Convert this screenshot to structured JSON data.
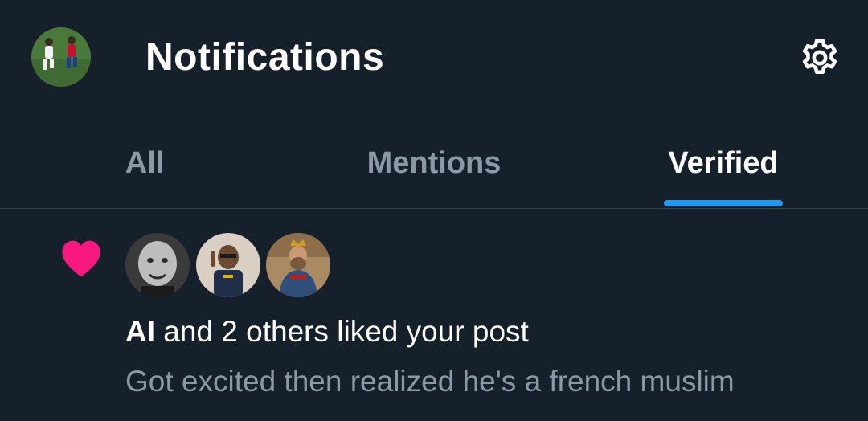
{
  "header": {
    "title": "Notifications",
    "avatar_icon": "profile-avatar",
    "settings_icon": "gear-icon"
  },
  "tabs": [
    {
      "label": "All",
      "active": false
    },
    {
      "label": "Mentions",
      "active": false
    },
    {
      "label": "Verified",
      "active": true
    }
  ],
  "notification": {
    "type_icon": "heart-icon",
    "actor": "AI",
    "action_text": " and 2 others liked your post",
    "post_preview": "Got excited then realized he's a french muslim",
    "liker_avatars": [
      "liker-avatar-1",
      "liker-avatar-2",
      "liker-avatar-3"
    ]
  },
  "colors": {
    "background": "#15202b",
    "accent": "#1d9bf0",
    "heart": "#f91880",
    "muted_text": "#8b98a5",
    "divider": "#38444d"
  }
}
